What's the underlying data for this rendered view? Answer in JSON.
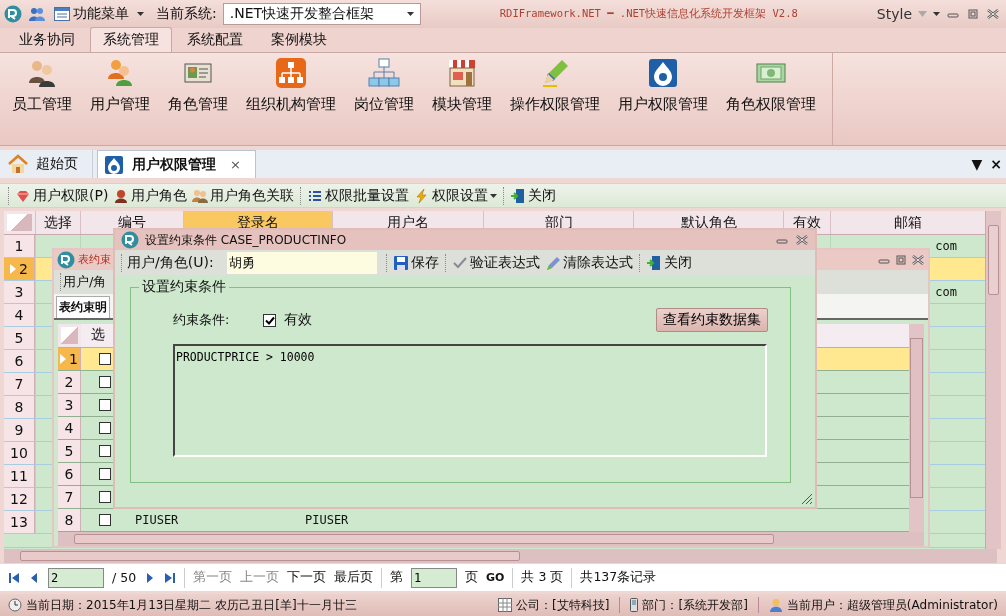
{
  "window": {
    "title": "RDIFramework.NET ━ .NET快速信息化系统开发框架 V2.8",
    "menu": "功能菜单",
    "system_label": "当前系统:",
    "system_value": ".NET快速开发整合框架",
    "style_label": "Style"
  },
  "ribbon_tabs": [
    {
      "label": "业务协同",
      "selected": false
    },
    {
      "label": "系统管理",
      "selected": true
    },
    {
      "label": "系统配置",
      "selected": false
    },
    {
      "label": "案例模块",
      "selected": false
    }
  ],
  "ribbon_items": [
    {
      "label": "员工管理"
    },
    {
      "label": "用户管理"
    },
    {
      "label": "角色管理"
    },
    {
      "label": "组织机构管理"
    },
    {
      "label": "岗位管理"
    },
    {
      "label": "模块管理"
    },
    {
      "label": "操作权限管理"
    },
    {
      "label": "用户权限管理"
    },
    {
      "label": "角色权限管理"
    }
  ],
  "doc_tabs": [
    {
      "label": "超始页",
      "selected": false
    },
    {
      "label": "用户权限管理",
      "selected": true,
      "close": "×"
    }
  ],
  "doc_tab_controls": {
    "list": "▼",
    "close": "×"
  },
  "toolbar": [
    [
      {
        "label": "用户权限(P)",
        "dropdown": false
      },
      {
        "label": "用户角色",
        "dropdown": false
      },
      {
        "label": "用户角色关联",
        "dropdown": false
      }
    ],
    [
      {
        "label": "权限批量设置",
        "dropdown": false
      },
      {
        "label": "权限设置",
        "dropdown": true
      }
    ],
    [
      {
        "label": "关闭",
        "dropdown": false
      }
    ]
  ],
  "grid": {
    "columns": [
      {
        "label": "选择",
        "selected": false
      },
      {
        "label": "编号",
        "selected": false
      },
      {
        "label": "登录名",
        "selected": true
      },
      {
        "label": "用户名",
        "selected": false
      },
      {
        "label": "部门",
        "selected": false
      },
      {
        "label": "默认角色",
        "selected": false
      },
      {
        "label": "有效",
        "selected": false
      },
      {
        "label": "邮箱",
        "selected": false
      }
    ],
    "rows": [
      {
        "number": "1",
        "selected": false,
        "email": "com"
      },
      {
        "number": "2",
        "selected": true
      },
      {
        "number": "3",
        "selected": false,
        "email": "com"
      },
      {
        "number": "4",
        "selected": false
      },
      {
        "number": "5",
        "selected": false
      },
      {
        "number": "6",
        "selected": false
      },
      {
        "number": "7",
        "selected": false
      },
      {
        "number": "8",
        "selected": false
      },
      {
        "number": "9",
        "selected": false
      },
      {
        "number": "10",
        "selected": false
      },
      {
        "number": "11",
        "selected": false
      },
      {
        "number": "12",
        "selected": false
      },
      {
        "number": "13",
        "selected": false
      }
    ]
  },
  "table_window": {
    "title": "表约束",
    "toolbar_label": "用户/角",
    "tab": "表约束明",
    "column": "选",
    "rows": [
      {
        "number": "1",
        "selected": true,
        "checked": false
      },
      {
        "number": "2",
        "selected": false,
        "checked": false
      },
      {
        "number": "3",
        "selected": false,
        "checked": false
      },
      {
        "number": "4",
        "selected": false,
        "checked": false
      },
      {
        "number": "5",
        "selected": false,
        "checked": false
      },
      {
        "number": "6",
        "selected": false,
        "checked": false
      },
      {
        "number": "7",
        "selected": false,
        "checked": false
      },
      {
        "number": "8",
        "selected": false,
        "checked": false,
        "cells": [
          "PIUSER",
          "PIUSER"
        ]
      }
    ]
  },
  "dialog": {
    "title": "设置约束条件 CASE_PRODUCTINFO",
    "user_label": "用户/角色(U):",
    "user_value": "胡勇",
    "toolbar": [
      [
        {
          "label": "保存"
        }
      ],
      [
        {
          "label": "验证表达式"
        },
        {
          "label": "清除表达式"
        }
      ],
      [
        {
          "label": "关闭"
        }
      ]
    ],
    "group_title": "设置约束条件",
    "condition_label": "约束条件:",
    "enabled": {
      "label": "有效",
      "checked": true
    },
    "view_button": "查看约束数据集",
    "expression": "PRODUCTPRICE > 10000"
  },
  "pager": {
    "page": "2",
    "total_pages": "/ 50",
    "links": [
      {
        "label": "第一页",
        "disabled": true
      },
      {
        "label": "上一页",
        "disabled": true
      },
      {
        "label": "下一页",
        "disabled": false
      },
      {
        "label": "最后页",
        "disabled": false
      }
    ],
    "goto_label": "第",
    "goto_value": "1",
    "goto_unit": "页",
    "go": "GO",
    "page_count": "共 3 页",
    "record_count": "共137条记录"
  },
  "status_bar": {
    "date": "当前日期：2015年1月13日星期二 农历己丑日[羊]十一月廿三",
    "company": "公司：[艾特科技]",
    "department": "部门：[系统开发部]",
    "user": "当前用户：超级管理员(Administrator)"
  }
}
